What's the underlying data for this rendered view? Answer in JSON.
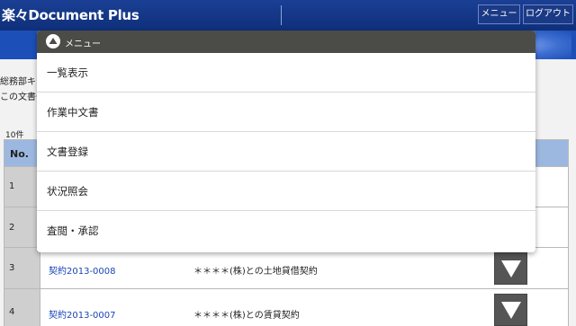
{
  "header": {
    "app_title": "楽々Document Plus",
    "menu_button": "メニュー",
    "logout_button": "ログアウト"
  },
  "page": {
    "department_text": "総務部キャ",
    "document_text": "この文書一",
    "count_text": "10件"
  },
  "table": {
    "header_no": "No.",
    "rows": [
      {
        "no": "1",
        "link": "",
        "title": ""
      },
      {
        "no": "2",
        "link": "",
        "title": ""
      },
      {
        "no": "3",
        "link": "契約2013-0008",
        "title": "＊＊＊＊(株)との土地貸借契約"
      },
      {
        "no": "4",
        "link": "契約2013-0007",
        "title": "＊＊＊＊(株)との賃貸契約"
      }
    ]
  },
  "menu": {
    "title": "メニュー",
    "items": [
      {
        "label": "一覧表示"
      },
      {
        "label": "作業中文書"
      },
      {
        "label": "文書登録"
      },
      {
        "label": "状況照会"
      },
      {
        "label": "査閲・承認"
      }
    ]
  },
  "colors": {
    "header_bg": "#0f2f7a",
    "band_bg": "#1d4fb8",
    "menu_header_bg": "#4b4c47",
    "table_header_bg": "#9db8e0",
    "link": "#1a45b8"
  }
}
